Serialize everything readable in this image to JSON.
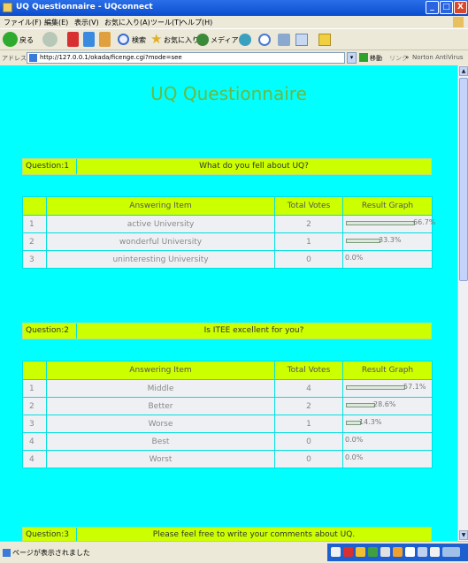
{
  "window": {
    "title": "UQ Questionnaire - UQconnect",
    "buttons": {
      "min": "_",
      "max": "□",
      "close": "X"
    }
  },
  "menu": [
    "ファイル(F)",
    "編集(E)",
    "表示(V)",
    "お気に入り(A)",
    "ツール(T)",
    "ヘルプ(H)"
  ],
  "toolbar": {
    "back": "戻る",
    "search": "検索",
    "favorites": "お気に入り",
    "media": "メディア"
  },
  "address": {
    "label": "アドレス(D)",
    "url": "http://127.0.0.1/okada/ficenge.cgi?mode=see",
    "go": "移動",
    "links": "リンク",
    "chevron": "»",
    "norton": "Norton AntiVirus"
  },
  "page": {
    "title": "UQ Questionnaire",
    "table_headers": {
      "item": "Answering Item",
      "votes": "Total Votes",
      "graph": "Result Graph"
    },
    "questions": [
      {
        "label": "Question:1",
        "text": "What do you fell about UQ?",
        "rows": [
          {
            "no": "1",
            "item": "active University",
            "votes": "2",
            "percent": "66.7%",
            "fraction": 0.667
          },
          {
            "no": "2",
            "item": "wonderful University",
            "votes": "1",
            "percent": "33.3%",
            "fraction": 0.333
          },
          {
            "no": "3",
            "item": "uninteresting University",
            "votes": "0",
            "percent": "0.0%",
            "fraction": 0
          }
        ]
      },
      {
        "label": "Question:2",
        "text": "Is ITEE excellent for you?",
        "rows": [
          {
            "no": "1",
            "item": "Middle",
            "votes": "4",
            "percent": "57.1%",
            "fraction": 0.571
          },
          {
            "no": "2",
            "item": "Better",
            "votes": "2",
            "percent": "28.6%",
            "fraction": 0.286
          },
          {
            "no": "3",
            "item": "Worse",
            "votes": "1",
            "percent": "14.3%",
            "fraction": 0.143
          },
          {
            "no": "4",
            "item": "Best",
            "votes": "0",
            "percent": "0.0%",
            "fraction": 0
          },
          {
            "no": "4",
            "item": "Worst",
            "votes": "0",
            "percent": "0.0%",
            "fraction": 0
          }
        ]
      },
      {
        "label": "Question:3",
        "text": "Please feel free to write your comments about UQ."
      }
    ]
  },
  "status": {
    "text": "ページが表示されました"
  },
  "colors": {
    "background": "#00ffff",
    "question_bar": "#ccff00",
    "title": "#66bb44",
    "cell": "#eff0f4"
  }
}
